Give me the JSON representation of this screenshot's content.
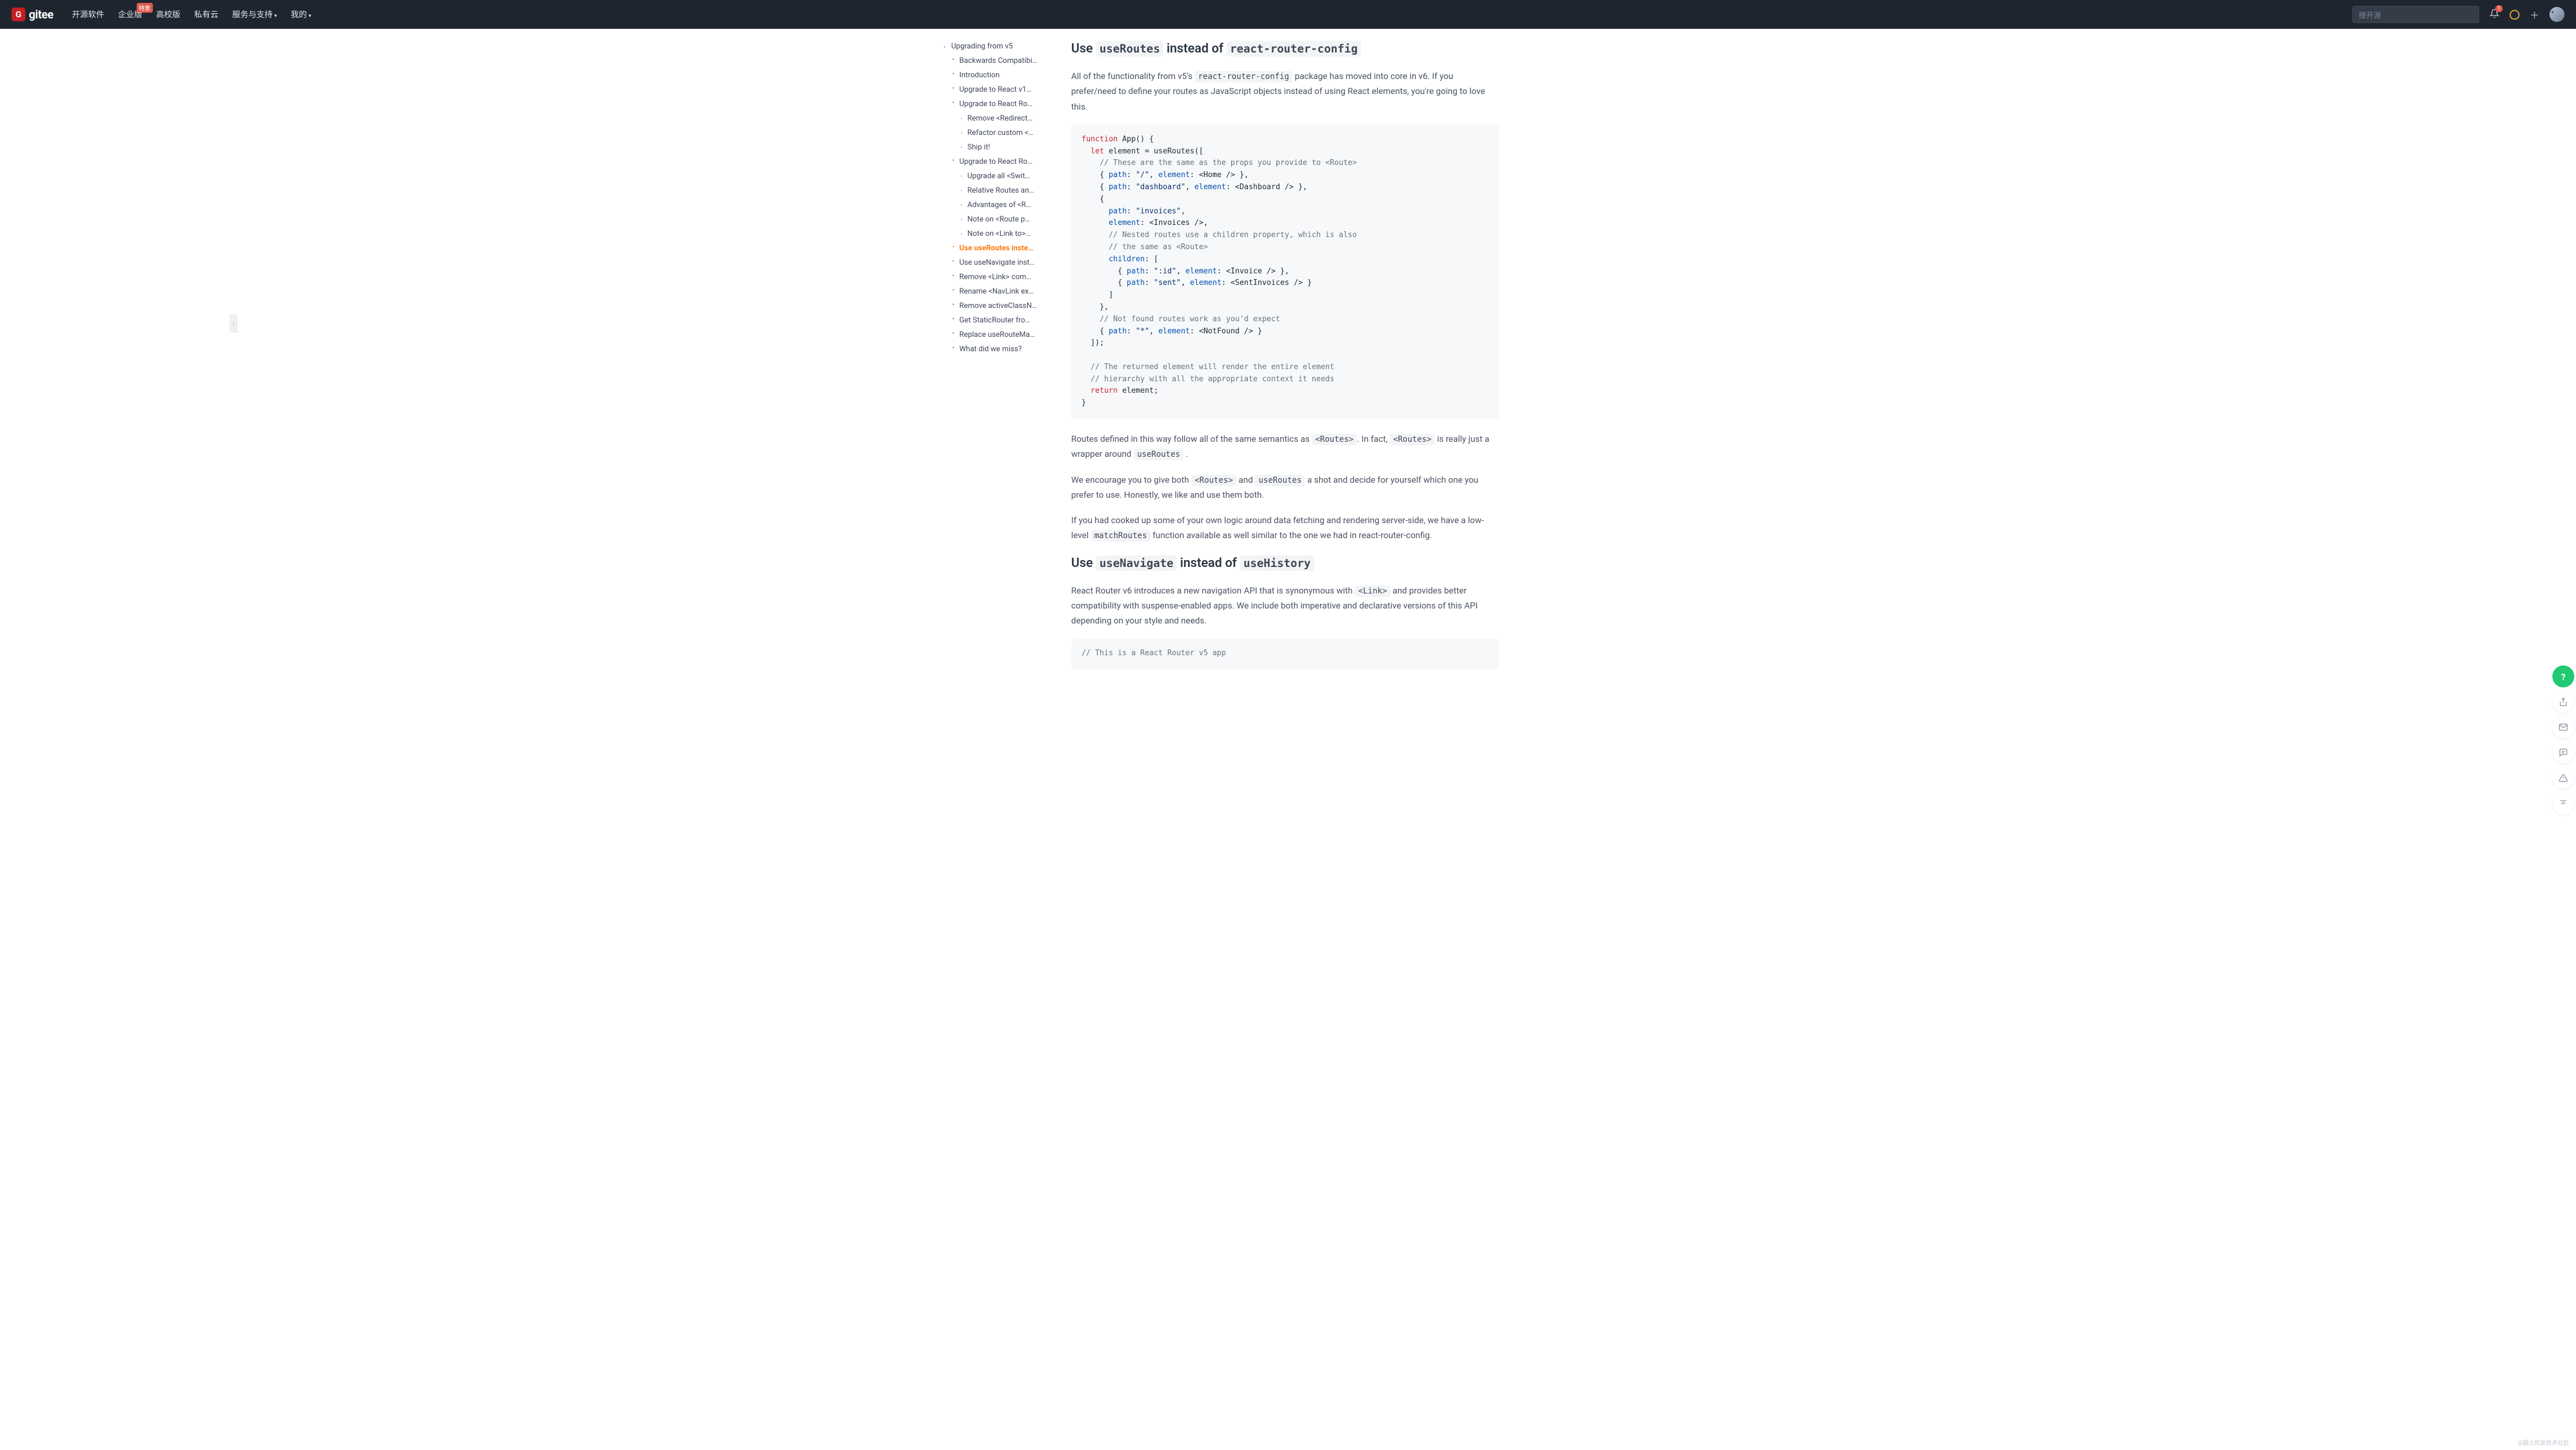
{
  "header": {
    "logo_text": "gitee",
    "nav": [
      {
        "label": "开源软件"
      },
      {
        "label": "企业版",
        "badge": "特惠"
      },
      {
        "label": "高校版"
      },
      {
        "label": "私有云"
      },
      {
        "label": "服务与支持",
        "caret": true
      },
      {
        "label": "我的",
        "caret": true
      }
    ],
    "search_placeholder": "搜开源",
    "notif_count": "1"
  },
  "sidebar": {
    "items": [
      {
        "level": 1,
        "label": "Upgrading from v5"
      },
      {
        "level": 2,
        "label": "Backwards Compatibi…"
      },
      {
        "level": 2,
        "label": "Introduction"
      },
      {
        "level": 2,
        "label": "Upgrade to React v1…"
      },
      {
        "level": 2,
        "label": "Upgrade to React Ro…"
      },
      {
        "level": 3,
        "label": "Remove <Redirect…"
      },
      {
        "level": 3,
        "label": "Refactor custom <…"
      },
      {
        "level": 3,
        "label": "Ship it!"
      },
      {
        "level": 2,
        "label": "Upgrade to React Ro…"
      },
      {
        "level": 3,
        "label": "Upgrade all <Swit…"
      },
      {
        "level": 3,
        "label": "Relative Routes an…"
      },
      {
        "level": 3,
        "label": "Advantages of <R…"
      },
      {
        "level": 3,
        "label": "Note on <Route p…"
      },
      {
        "level": 3,
        "label": "Note on <Link to>…"
      },
      {
        "level": 2,
        "label": "Use useRoutes inste…",
        "active": true
      },
      {
        "level": 2,
        "label": "Use useNavigate inst…"
      },
      {
        "level": 2,
        "label": "Remove <Link> com…"
      },
      {
        "level": 2,
        "label": "Rename <NavLink ex…"
      },
      {
        "level": 2,
        "label": "Remove activeClassN…"
      },
      {
        "level": 2,
        "label": "Get StaticRouter fro…"
      },
      {
        "level": 2,
        "label": "Replace useRouteMa…"
      },
      {
        "level": 2,
        "label": "What did we miss?"
      }
    ]
  },
  "content": {
    "h1_pre": "Use ",
    "h1_code1": "useRoutes",
    "h1_mid": " instead of ",
    "h1_code2": "react-router-config",
    "p1_a": "All of the functionality from v5's ",
    "p1_code": "react-router-config",
    "p1_b": " package has moved into core in v6. If you prefer/need to define your routes as JavaScript objects instead of using React elements, you're going to love this.",
    "p2_a": "Routes defined in this way follow all of the same semantics as ",
    "p2_code1": "<Routes>",
    "p2_b": ". In fact, ",
    "p2_code2": "<Routes>",
    "p2_c": " is really just a wrapper around ",
    "p2_code3": "useRoutes",
    "p2_d": " .",
    "p3_a": "We encourage you to give both ",
    "p3_code1": "<Routes>",
    "p3_b": " and ",
    "p3_code2": "useRoutes",
    "p3_c": " a shot and decide for yourself which one you prefer to use. Honestly, we like and use them both.",
    "p4_a": "If you had cooked up some of your own logic around data fetching and rendering server-side, we have a low-level ",
    "p4_code": "matchRoutes",
    "p4_b": " function available as well similar to the one we had in react-router-config.",
    "h2_pre": "Use ",
    "h2_code1": "useNavigate",
    "h2_mid": " instead of ",
    "h2_code2": "useHistory",
    "p5_a": "React Router v6 introduces a new navigation API that is synonymous with ",
    "p5_code": "<Link>",
    "p5_b": " and provides better compatibility with suspense-enabled apps. We include both imperative and declarative versions of this API depending on your style and needs.",
    "code2_com": "// This is a React Router v5 app"
  },
  "code": {
    "l1_kw": "function",
    "l1_fn": " App() {",
    "l2_kw": "let",
    "l2_a": " element = useRoutes([",
    "l3": "// These are the same as the props you provide to <Route>",
    "l4_a": "{ ",
    "l4_k1": "path",
    "l4_b": ": ",
    "l4_s1": "\"/\"",
    "l4_c": ", ",
    "l4_k2": "element",
    "l4_d": ": <Home /> },",
    "l5_a": "{ ",
    "l5_k1": "path",
    "l5_b": ": ",
    "l5_s1": "\"dashboard\"",
    "l5_c": ", ",
    "l5_k2": "element",
    "l5_d": ": <Dashboard /> },",
    "l6": "{",
    "l7_k": "path",
    "l7_a": ": ",
    "l7_s": "\"invoices\"",
    "l7_b": ",",
    "l8_k": "element",
    "l8_a": ": <Invoices />,",
    "l9": "// Nested routes use a children property, which is also",
    "l10": "// the same as <Route>",
    "l11_k": "children",
    "l11_a": ": [",
    "l12_a": "{ ",
    "l12_k1": "path",
    "l12_b": ": ",
    "l12_s1": "\":id\"",
    "l12_c": ", ",
    "l12_k2": "element",
    "l12_d": ": <Invoice /> },",
    "l13_a": "{ ",
    "l13_k1": "path",
    "l13_b": ": ",
    "l13_s1": "\"sent\"",
    "l13_c": ", ",
    "l13_k2": "element",
    "l13_d": ": <SentInvoices /> }",
    "l14": "]",
    "l15": "},",
    "l16": "// Not found routes work as you'd expect",
    "l17_a": "{ ",
    "l17_k1": "path",
    "l17_b": ": ",
    "l17_s1": "\"*\"",
    "l17_c": ", ",
    "l17_k2": "element",
    "l17_d": ": <NotFound /> }",
    "l18": "]);",
    "l19": "",
    "l20": "// The returned element will render the entire element",
    "l21": "// hierarchy with all the appropriate context it needs",
    "l22_kw": "return",
    "l22_a": " element;",
    "l23": "}"
  },
  "watermark": "@掘土挖友技术社区"
}
